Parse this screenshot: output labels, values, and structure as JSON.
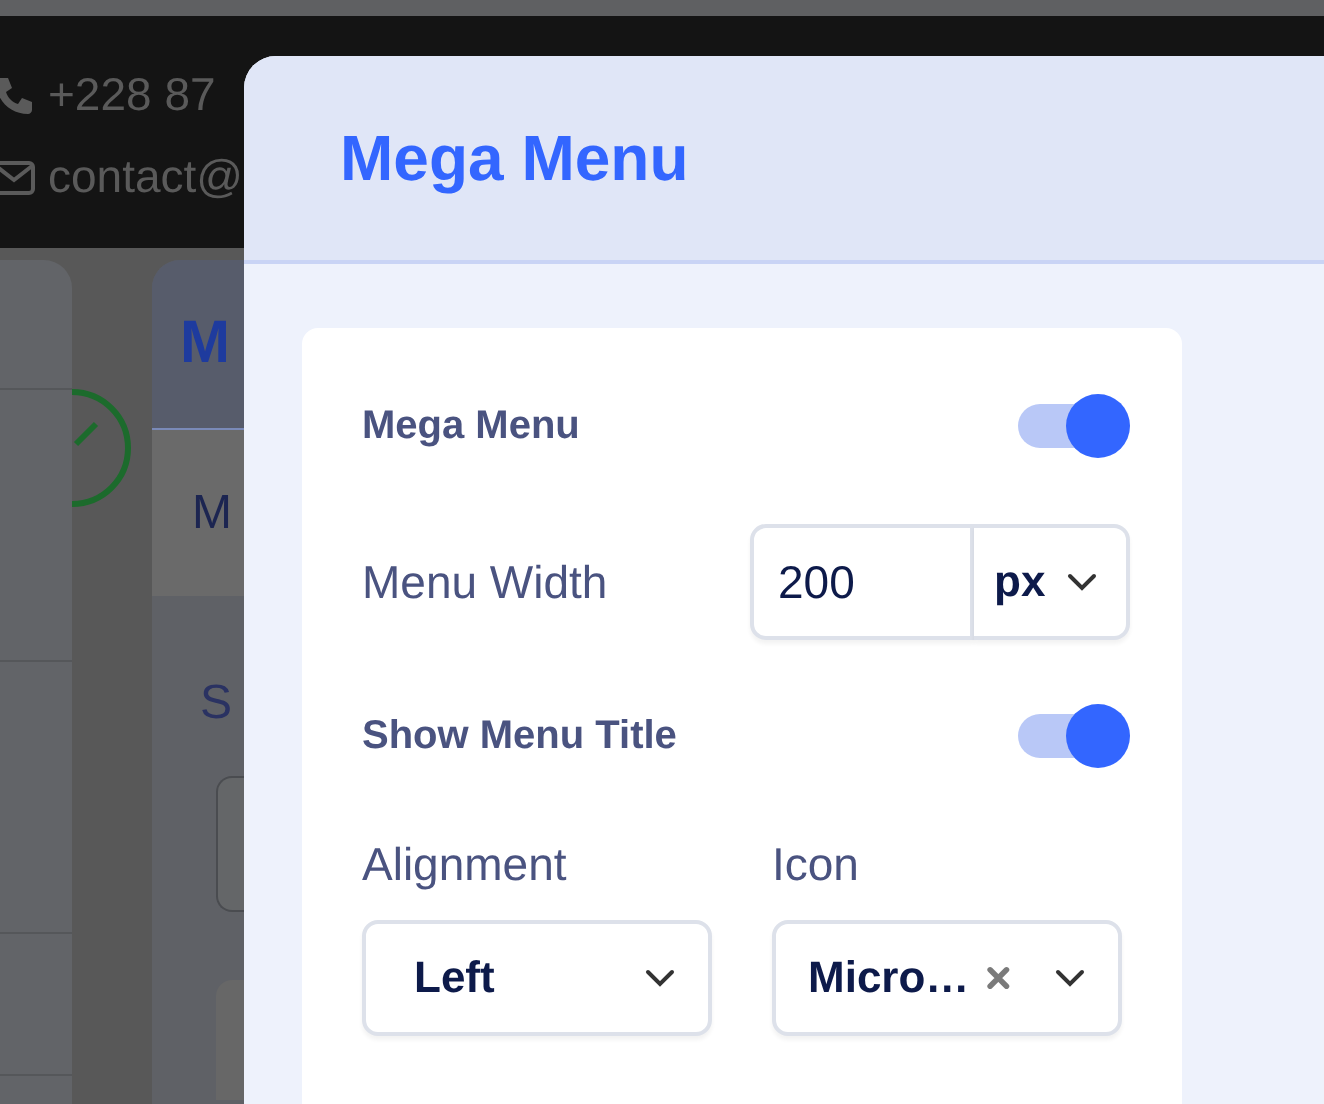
{
  "background": {
    "phone": "+228 87",
    "email": "contact@",
    "header_letter": "M",
    "tab_letter": "M",
    "label_letter": "S"
  },
  "modal": {
    "title": "Mega Menu",
    "fields": [
      {
        "kind": "toggle",
        "label": "Mega Menu",
        "on": true
      },
      {
        "kind": "width",
        "label": "Menu Width",
        "value": "200",
        "unit": "px"
      },
      {
        "kind": "toggle",
        "label": "Show Menu Title",
        "on": true
      }
    ],
    "selects": [
      {
        "label": "Alignment",
        "value": "Left",
        "clearable": false
      },
      {
        "label": "Icon",
        "value": "Micro…",
        "clearable": true
      }
    ]
  }
}
